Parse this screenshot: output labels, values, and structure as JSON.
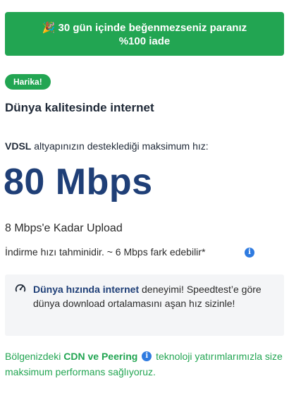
{
  "banner": {
    "emoji": "🎉",
    "text": "30 gün içinde beğenmezseniz paranız %100 iade"
  },
  "badge": {
    "label": "Harika!"
  },
  "title": "Dünya kalitesinde internet",
  "infra": {
    "tech": "VDSL",
    "text": " altyapınızın desteklediği maksimum hız:"
  },
  "speed": {
    "value": "80 Mbps"
  },
  "upload": "8 Mbps'e Kadar Upload",
  "estimate": "İndirme hızı tahminidir. ~ 6 Mbps fark edebilir*",
  "info_icon": "i",
  "world": {
    "highlight": "Dünya hızında internet",
    "text": " deneyimi! Speedtest’e göre dünya download ortalamasını aşan hız sizinle!"
  },
  "region": {
    "prefix": "Bölgenizdeki ",
    "highlight": "CDN ve Peering",
    "suffix": " teknoloji yatırımlarımızla size maksimum performans sağlıyoruz."
  },
  "colors": {
    "brand_green": "#22a552",
    "speed_blue": "#1f3f77",
    "info_blue": "#2f7be0",
    "box_bg": "#f4f5f7"
  }
}
